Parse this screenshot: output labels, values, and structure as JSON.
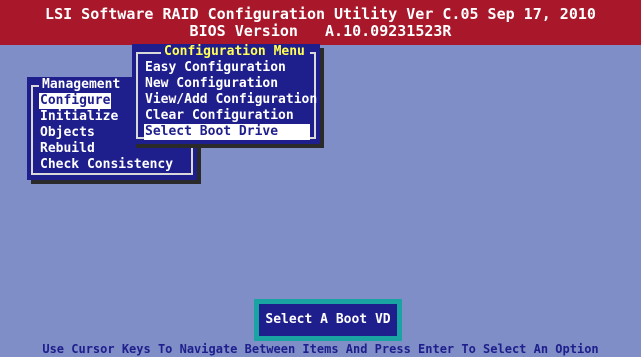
{
  "title": {
    "line1": "LSI Software RAID Configuration Utility Ver C.05 Sep 17, 2010",
    "line2": "BIOS Version   A.10.09231523R"
  },
  "management_menu": {
    "title": "Management",
    "items": [
      "Configure",
      "Initialize",
      "Objects",
      "Rebuild",
      "Check Consistency"
    ],
    "selected": "Configure"
  },
  "configuration_menu": {
    "title": "Configuration Menu",
    "items": [
      "Easy Configuration",
      "New Configuration",
      "View/Add Configuration",
      "Clear Configuration",
      "Select Boot Drive"
    ],
    "selected": "Select Boot Drive"
  },
  "prompt": {
    "text": "Select A Boot VD"
  },
  "status_bar": {
    "text": "Use Cursor Keys To Navigate Between Items And Press Enter To Select An Option"
  },
  "colors": {
    "background": "#7f8ec6",
    "title_bar": "#a8172a",
    "window": "#1e1e8c",
    "prompt_border": "#1aa3a3",
    "highlight": "#ffffff"
  }
}
